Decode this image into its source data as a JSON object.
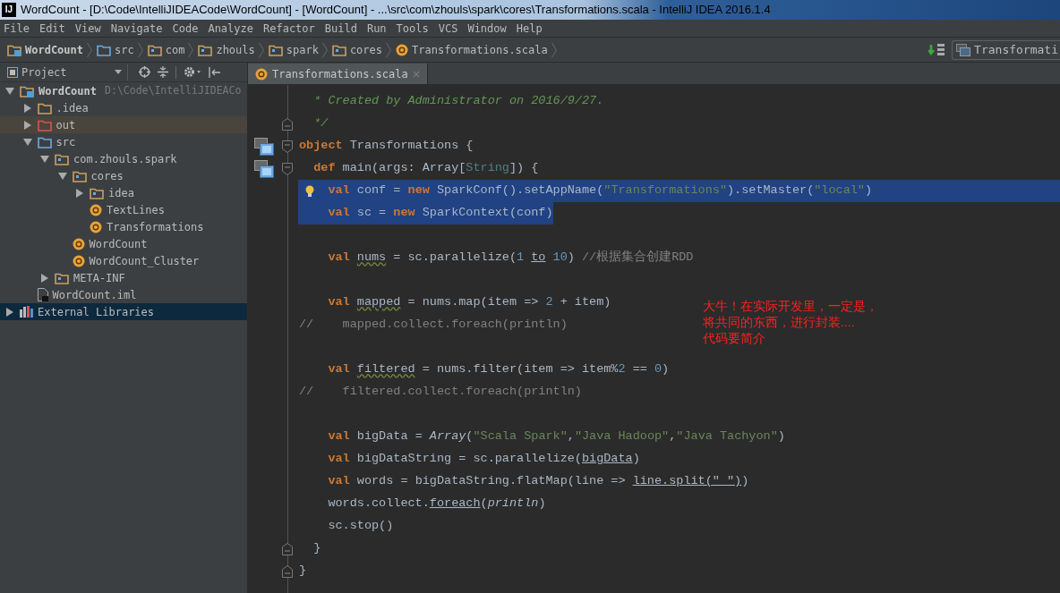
{
  "window": {
    "logo": "IJ",
    "title": "WordCount - [D:\\Code\\IntelliJIDEACode\\WordCount] - [WordCount] - ...\\src\\com\\zhouls\\spark\\cores\\Transformations.scala - IntelliJ IDEA 2016.1.4"
  },
  "menu": [
    "File",
    "Edit",
    "View",
    "Navigate",
    "Code",
    "Analyze",
    "Refactor",
    "Build",
    "Run",
    "Tools",
    "VCS",
    "Window",
    "Help"
  ],
  "breadcrumbs": [
    {
      "kind": "project",
      "label": "WordCount"
    },
    {
      "kind": "source",
      "label": "src"
    },
    {
      "kind": "package",
      "label": "com"
    },
    {
      "kind": "package",
      "label": "zhouls"
    },
    {
      "kind": "package",
      "label": "spark"
    },
    {
      "kind": "package",
      "label": "cores"
    },
    {
      "kind": "class",
      "label": "Transformations.scala"
    }
  ],
  "run_config": {
    "label": "Transformati"
  },
  "project_panel": {
    "title": "Project",
    "tree": [
      {
        "kind": "project",
        "label": "WordCount",
        "path": "D:\\Code\\IntelliJIDEACo",
        "expanded": true,
        "selected": false,
        "highlighted": false,
        "children": [
          {
            "kind": "folder",
            "label": ".idea",
            "expanded": false,
            "selected": false,
            "highlighted": false
          },
          {
            "kind": "excluded",
            "label": "out",
            "expanded": false,
            "selected": false,
            "highlighted": true
          },
          {
            "kind": "source",
            "label": "src",
            "expanded": true,
            "selected": false,
            "highlighted": false,
            "children": [
              {
                "kind": "package",
                "label": "com.zhouls.spark",
                "expanded": true,
                "selected": false,
                "highlighted": false,
                "children": [
                  {
                    "kind": "package",
                    "label": "cores",
                    "expanded": true,
                    "selected": false,
                    "highlighted": false,
                    "children": [
                      {
                        "kind": "package",
                        "label": "idea",
                        "expanded": false,
                        "selected": false,
                        "highlighted": false
                      },
                      {
                        "kind": "class",
                        "label": "TextLines",
                        "selected": false,
                        "highlighted": false
                      },
                      {
                        "kind": "class",
                        "label": "Transformations",
                        "selected": false,
                        "highlighted": false
                      }
                    ]
                  },
                  {
                    "kind": "class",
                    "label": "WordCount",
                    "selected": false,
                    "highlighted": false
                  },
                  {
                    "kind": "class",
                    "label": "WordCount_Cluster",
                    "selected": false,
                    "highlighted": false
                  }
                ]
              },
              {
                "kind": "package",
                "label": "META-INF",
                "expanded": false,
                "selected": false,
                "highlighted": false
              }
            ]
          },
          {
            "kind": "file",
            "label": "WordCount.iml",
            "selected": false,
            "highlighted": false
          }
        ]
      },
      {
        "kind": "library",
        "label": "External Libraries",
        "expanded": false,
        "selected": true
      }
    ]
  },
  "editor": {
    "tab": {
      "label": "Transformations.scala",
      "selected": true
    },
    "lines": [
      {
        "kind": "code",
        "selected": false,
        "tokens": [
          {
            "kind": "doc",
            "text": "  * Created by Administrator on 2016/9/27."
          }
        ]
      },
      {
        "kind": "code",
        "selected": false,
        "fold_close": true,
        "tokens": [
          {
            "kind": "doc",
            "text": "  */"
          }
        ]
      },
      {
        "kind": "code",
        "selected": false,
        "fold_open": true,
        "override_marker": true,
        "tokens": [
          {
            "kind": "kw",
            "text": "object"
          },
          {
            "kind": "id",
            "text": " Transformations {"
          }
        ]
      },
      {
        "kind": "code",
        "selected": false,
        "fold_open": true,
        "override_marker": true,
        "tokens": [
          {
            "kind": "kw",
            "text": "  def"
          },
          {
            "kind": "id",
            "text": " main(args: Array["
          },
          {
            "kind": "type",
            "text": "String"
          },
          {
            "kind": "id",
            "text": "]) {"
          }
        ]
      },
      {
        "kind": "code",
        "selected": true,
        "intention_bulb": true,
        "tokens": [
          {
            "kind": "kw",
            "text": "    val"
          },
          {
            "kind": "id",
            "text": " conf = "
          },
          {
            "kind": "kw",
            "text": "new"
          },
          {
            "kind": "id",
            "text": " SparkConf().setAppName("
          },
          {
            "kind": "str",
            "text": "\"Transformations\""
          },
          {
            "kind": "id",
            "text": ").setMaster("
          },
          {
            "kind": "str",
            "text": "\"local\""
          },
          {
            "kind": "id",
            "text": ")"
          }
        ]
      },
      {
        "kind": "code",
        "selected": true,
        "tokens": [
          {
            "kind": "kw",
            "text": "    val"
          },
          {
            "kind": "id",
            "text": " sc = "
          },
          {
            "kind": "kw",
            "text": "new"
          },
          {
            "kind": "id",
            "text": " SparkContext(conf)"
          }
        ]
      },
      {
        "kind": "blank"
      },
      {
        "kind": "code",
        "selected": false,
        "tokens": [
          {
            "kind": "kw",
            "text": "    val "
          },
          {
            "kind": "warn",
            "text": "nums"
          },
          {
            "kind": "id",
            "text": " = sc.parallelize("
          },
          {
            "kind": "num",
            "text": "1 "
          },
          {
            "kind": "implicit",
            "text": "to"
          },
          {
            "kind": "num",
            "text": " 10"
          },
          {
            "kind": "id",
            "text": ") "
          },
          {
            "kind": "cmt",
            "text": "//根据集合创建RDD"
          }
        ]
      },
      {
        "kind": "blank"
      },
      {
        "kind": "code",
        "selected": false,
        "tokens": [
          {
            "kind": "kw",
            "text": "    val "
          },
          {
            "kind": "warn",
            "text": "mapped"
          },
          {
            "kind": "id",
            "text": " = nums.map(item => "
          },
          {
            "kind": "num",
            "text": "2"
          },
          {
            "kind": "id",
            "text": " + item)"
          }
        ]
      },
      {
        "kind": "code",
        "selected": false,
        "tokens": [
          {
            "kind": "cmt",
            "text": "//    mapped.collect.foreach(println)"
          }
        ]
      },
      {
        "kind": "blank"
      },
      {
        "kind": "code",
        "selected": false,
        "tokens": [
          {
            "kind": "kw",
            "text": "    val "
          },
          {
            "kind": "warn",
            "text": "filtered"
          },
          {
            "kind": "id",
            "text": " = nums.filter(item => item%"
          },
          {
            "kind": "num",
            "text": "2"
          },
          {
            "kind": "id",
            "text": " == "
          },
          {
            "kind": "num",
            "text": "0"
          },
          {
            "kind": "id",
            "text": ")"
          }
        ]
      },
      {
        "kind": "code",
        "selected": false,
        "tokens": [
          {
            "kind": "cmt",
            "text": "//    filtered.collect.foreach(println)"
          }
        ]
      },
      {
        "kind": "blank"
      },
      {
        "kind": "code",
        "selected": false,
        "tokens": [
          {
            "kind": "kw",
            "text": "    val"
          },
          {
            "kind": "id",
            "text": " bigData = "
          },
          {
            "kind": "italic",
            "text": "Array"
          },
          {
            "kind": "id",
            "text": "("
          },
          {
            "kind": "str",
            "text": "\"Scala Spark\""
          },
          {
            "kind": "id",
            "text": ","
          },
          {
            "kind": "str",
            "text": "\"Java Hadoop\""
          },
          {
            "kind": "id",
            "text": ","
          },
          {
            "kind": "str",
            "text": "\"Java Tachyon\""
          },
          {
            "kind": "id",
            "text": ")"
          }
        ]
      },
      {
        "kind": "code",
        "selected": false,
        "tokens": [
          {
            "kind": "kw",
            "text": "    val"
          },
          {
            "kind": "id",
            "text": " bigDataString = sc.parallelize("
          },
          {
            "kind": "implicit",
            "text": "bigData"
          },
          {
            "kind": "id",
            "text": ")"
          }
        ]
      },
      {
        "kind": "code",
        "selected": false,
        "tokens": [
          {
            "kind": "kw",
            "text": "    val"
          },
          {
            "kind": "id",
            "text": " words = bigDataString.flatMap(line => "
          },
          {
            "kind": "implicit",
            "text": "line.split(\" \")"
          },
          {
            "kind": "id",
            "text": ")"
          }
        ]
      },
      {
        "kind": "code",
        "selected": false,
        "tokens": [
          {
            "kind": "id",
            "text": "    words.collect."
          },
          {
            "kind": "implicit",
            "text": "foreach"
          },
          {
            "kind": "id",
            "text": "("
          },
          {
            "kind": "italic",
            "text": "println"
          },
          {
            "kind": "id",
            "text": ")"
          }
        ]
      },
      {
        "kind": "code",
        "selected": false,
        "tokens": [
          {
            "kind": "id",
            "text": "    sc.stop()"
          }
        ]
      },
      {
        "kind": "code",
        "selected": false,
        "fold_close": true,
        "tokens": [
          {
            "kind": "id",
            "text": "  }"
          }
        ]
      },
      {
        "kind": "code",
        "selected": false,
        "fold_close": true,
        "tokens": [
          {
            "kind": "id",
            "text": "}"
          }
        ]
      }
    ],
    "annotation": [
      "大牛！在实际开发里，一定是，",
      "将共同的东西，进行封装....",
      "代码要简介"
    ]
  }
}
